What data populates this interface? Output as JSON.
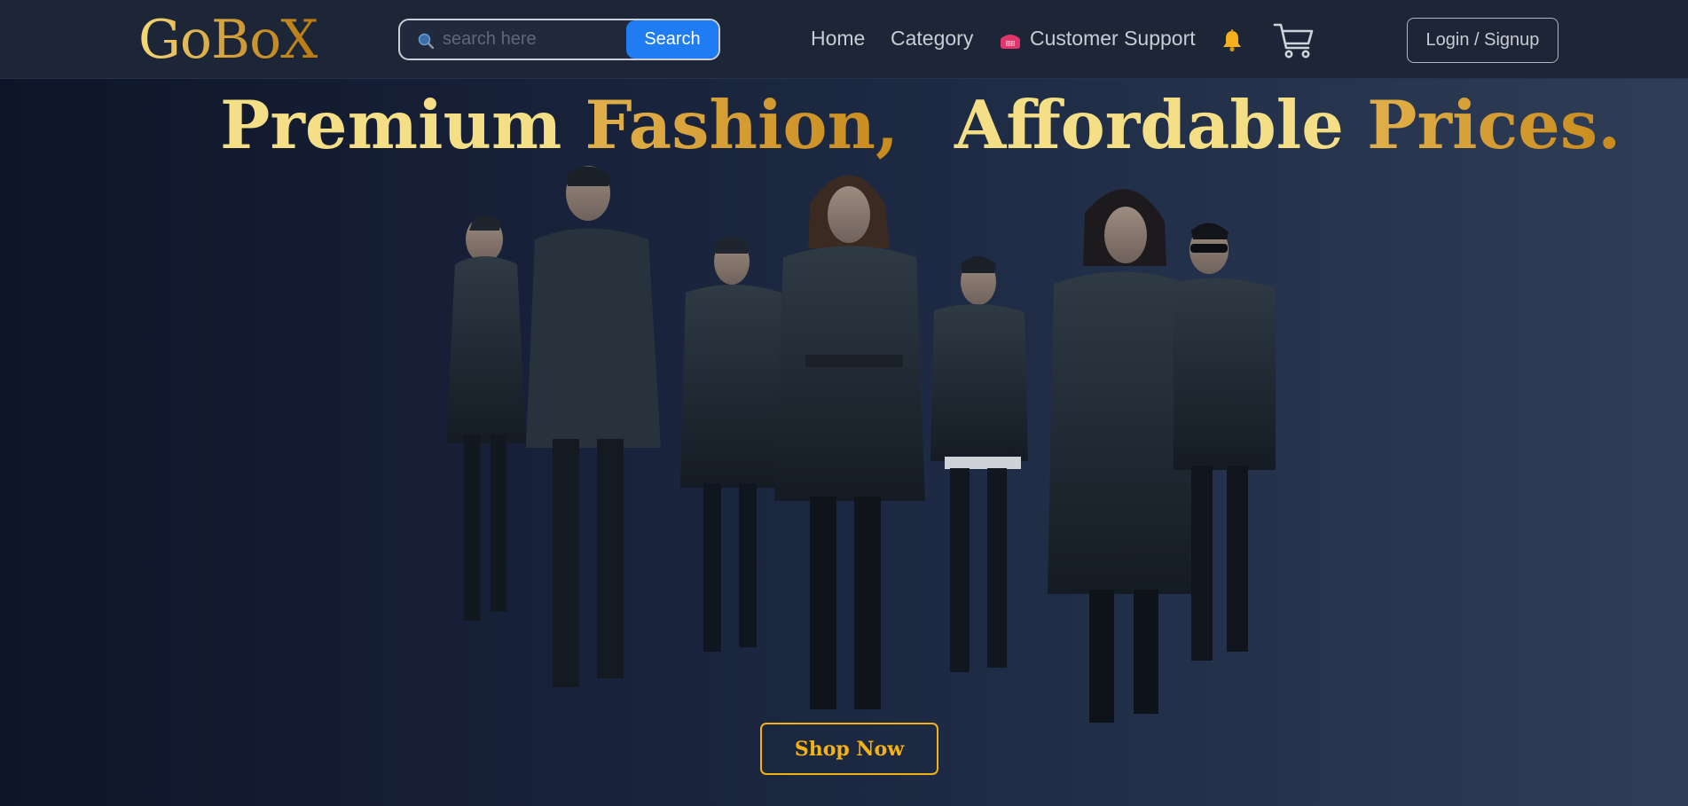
{
  "brand": {
    "logo": "GoBoX"
  },
  "search": {
    "placeholder": "search here",
    "value": "",
    "button": "Search"
  },
  "nav": {
    "home": "Home",
    "category": "Category",
    "support": "Customer Support",
    "support_icon": "telephone-icon",
    "notifications_icon": "bell-icon",
    "cart_icon": "cart-icon",
    "login": "Login / Signup"
  },
  "hero": {
    "title_part1": "Premium",
    "title_part2": "Fashion,",
    "title_part3": "Affordable",
    "title_part4": "Prices.",
    "image": "group-of-fashion-models-photo",
    "cta": "Shop Now"
  },
  "colors": {
    "background_dark": "#0e1528",
    "navbar": "#1c2636",
    "accent_gold": "#d6a541",
    "search_button": "#1f7cf2",
    "cta_border": "#f0b313"
  }
}
